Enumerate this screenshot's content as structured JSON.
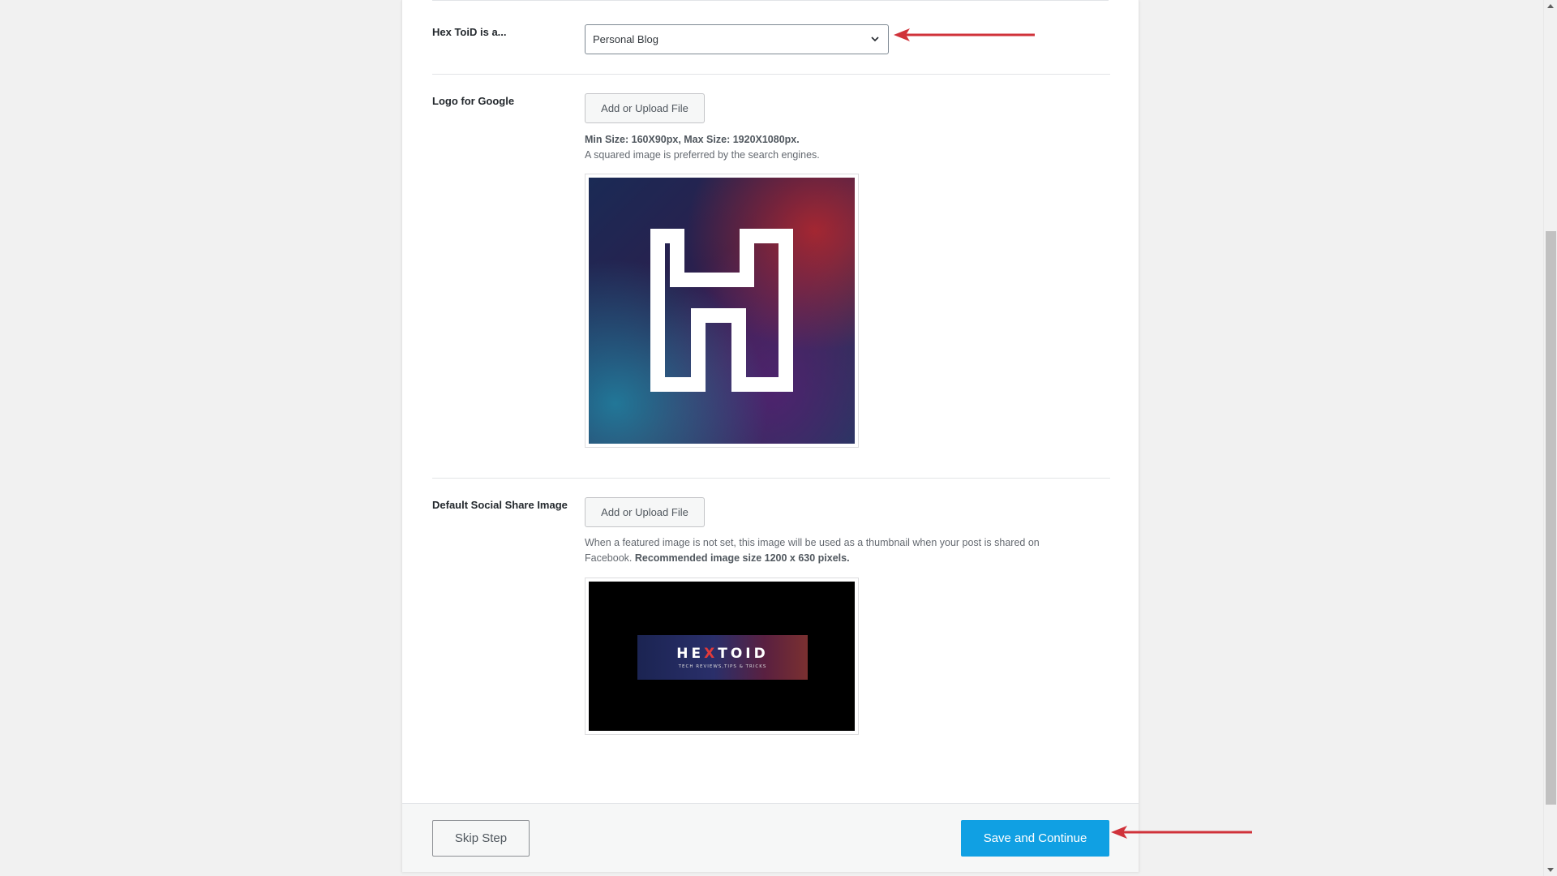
{
  "fields": {
    "site_type": {
      "label": "Hex ToiD is a...",
      "selected": "Personal Blog"
    },
    "logo": {
      "label": "Logo for Google",
      "upload_label": "Add or Upload File",
      "size_note": "Min Size: 160X90px, Max Size: 1920X1080px.",
      "hint": "A squared image is preferred by the search engines."
    },
    "social": {
      "label": "Default Social Share Image",
      "upload_label": "Add or Upload File",
      "desc": "When a featured image is not set, this image will be used as a thumbnail when your post is shared on Facebook.",
      "desc_bold": "Recommended image size 1200 x 630 pixels.",
      "banner_title_pre": "HE",
      "banner_title_x": "X",
      "banner_title_post": "TOID",
      "banner_subtitle": "TECH REVIEWS,TIPS & TRICKS"
    }
  },
  "footer": {
    "skip_label": "Skip Step",
    "save_label": "Save and Continue"
  },
  "colors": {
    "primary_button": "#10a0e3",
    "annotation_arrow": "#d0323a"
  },
  "icons": {
    "select_chevron": "chevron-down-icon",
    "annotation": "arrow-left-icon"
  }
}
